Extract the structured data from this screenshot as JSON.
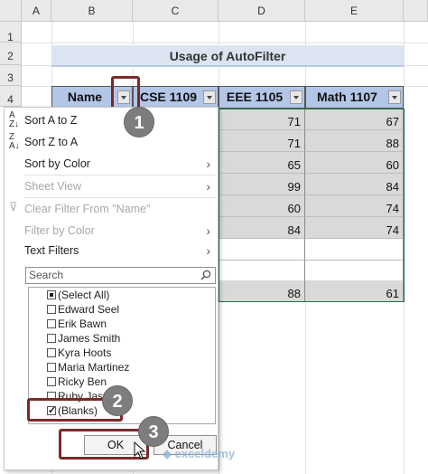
{
  "columns": [
    "A",
    "B",
    "C",
    "D",
    "E"
  ],
  "rows": [
    "1",
    "2",
    "3",
    "4"
  ],
  "title": "Usage of AutoFilter",
  "headers": [
    "Name",
    "CSE 1109",
    "EEE 1105",
    "Math 1107"
  ],
  "data_d": [
    "71",
    "71",
    "65",
    "99",
    "60",
    "84",
    "",
    "",
    "88"
  ],
  "data_e": [
    "67",
    "88",
    "60",
    "84",
    "74",
    "74",
    "",
    "",
    "61"
  ],
  "menu": {
    "sort_az": "Sort A to Z",
    "sort_za": "Sort Z to A",
    "sort_color": "Sort by Color",
    "sheet_view": "Sheet View",
    "clear_filter": "Clear Filter From \"Name\"",
    "filter_color": "Filter by Color",
    "text_filters": "Text Filters",
    "search_placeholder": "Search",
    "items": [
      "(Select All)",
      "Edward Seel",
      "Erik Bawn",
      "James Smith",
      "Kyra Hoots",
      "Maria Martinez",
      "Ricky Ben",
      "Ruby Jason",
      "(Blanks)"
    ],
    "ok": "OK",
    "cancel": "Cancel"
  },
  "badges": [
    "1",
    "2",
    "3"
  ],
  "watermark": "exceldemy",
  "colors": {
    "header_fill": "#b4c6e7",
    "callout": "#7a2a2a",
    "badge": "#7d7d7d"
  }
}
